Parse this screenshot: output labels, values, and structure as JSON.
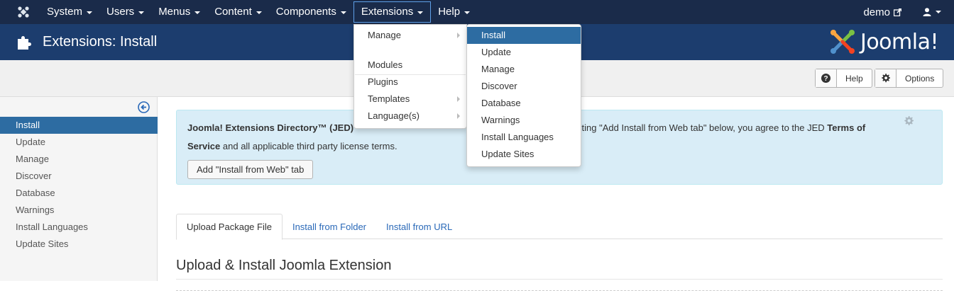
{
  "topnav": {
    "menus": [
      {
        "label": "System"
      },
      {
        "label": "Users"
      },
      {
        "label": "Menus"
      },
      {
        "label": "Content"
      },
      {
        "label": "Components"
      },
      {
        "label": "Extensions"
      },
      {
        "label": "Help"
      }
    ],
    "user_label": "demo"
  },
  "header": {
    "title": "Extensions: Install",
    "brand": "Joomla!"
  },
  "toolbar": {
    "help_label": "Help",
    "options_label": "Options"
  },
  "sidebar": {
    "items": [
      {
        "label": "Install"
      },
      {
        "label": "Update"
      },
      {
        "label": "Manage"
      },
      {
        "label": "Discover"
      },
      {
        "label": "Database"
      },
      {
        "label": "Warnings"
      },
      {
        "label": "Install Languages"
      },
      {
        "label": "Update Sites"
      }
    ]
  },
  "jed": {
    "text_bold_1": "Joomla! Extensions Directory™ (JED)",
    "text_mid": "electing \"Add Install from Web tab\" below, you agree to the JED",
    "text_bold_2": "Terms of Service",
    "text_end": "and all applicable third party license terms.",
    "button_label": "Add \"Install from Web\" tab"
  },
  "tabs": [
    {
      "label": "Upload Package File"
    },
    {
      "label": "Install from Folder"
    },
    {
      "label": "Install from URL"
    }
  ],
  "section_title": "Upload & Install Joomla Extension",
  "extensions_menu": {
    "items": [
      {
        "label": "Manage"
      },
      {
        "label": "Modules"
      },
      {
        "label": "Plugins"
      },
      {
        "label": "Templates"
      },
      {
        "label": "Language(s)"
      }
    ]
  },
  "manage_submenu": {
    "items": [
      {
        "label": "Install"
      },
      {
        "label": "Update"
      },
      {
        "label": "Manage"
      },
      {
        "label": "Discover"
      },
      {
        "label": "Database"
      },
      {
        "label": "Warnings"
      },
      {
        "label": "Install Languages"
      },
      {
        "label": "Update Sites"
      }
    ]
  },
  "colors": {
    "topnav_bg": "#1a2b4a",
    "header_bg": "#1c3d6e",
    "active_bg": "#2d6ca2",
    "link": "#2a69b8",
    "info_bg": "#d9edf7"
  }
}
